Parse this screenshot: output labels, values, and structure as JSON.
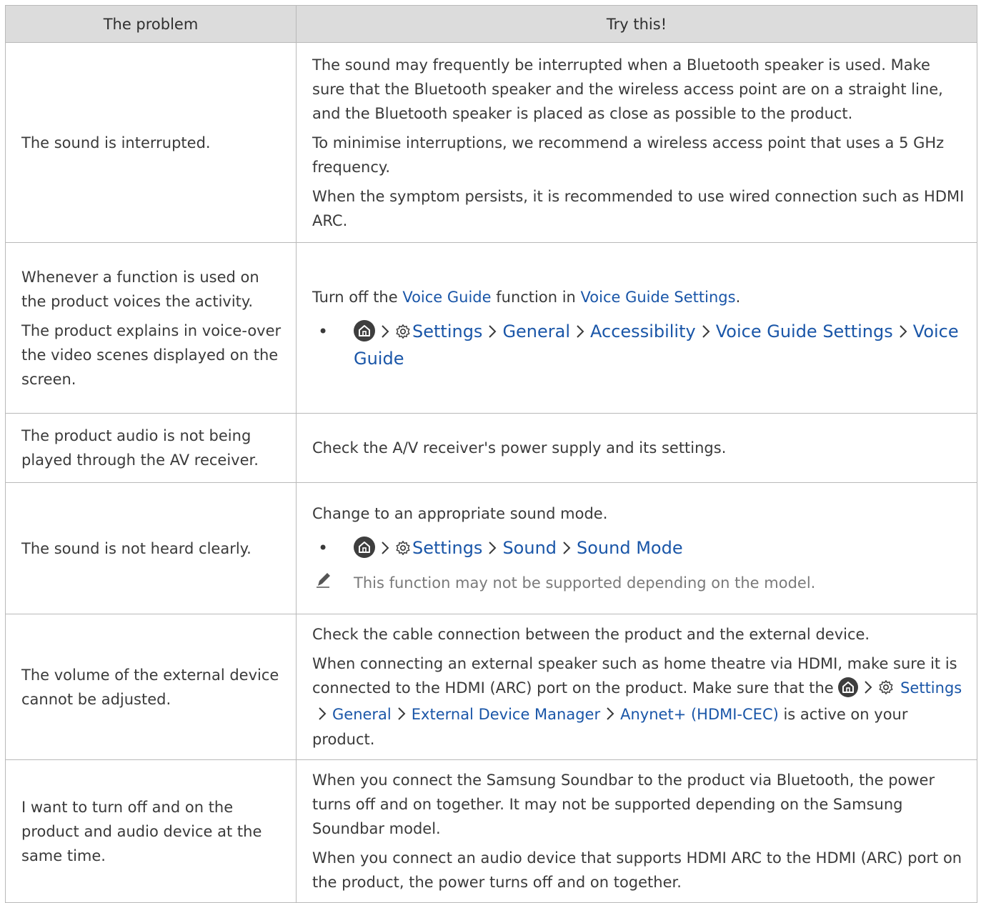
{
  "headers": {
    "problem": "The problem",
    "solution": "Try this!"
  },
  "rows": [
    {
      "problem": [
        "The sound is interrupted."
      ],
      "solution": [
        "The sound may frequently be interrupted when a Bluetooth speaker is used. Make sure that the Bluetooth speaker and the wireless access point are on a straight line, and the Bluetooth speaker is placed as close as possible to the product.",
        "To minimise interruptions, we recommend a wireless access point that uses a 5 GHz frequency.",
        "When the symptom persists, it is recommended to use wired connection such as HDMI ARC."
      ]
    },
    {
      "problem": [
        "Whenever a function is used on the product voices the activity.",
        "The product explains in voice-over the video scenes displayed on the screen."
      ],
      "solution_intro": {
        "before": "Turn off the ",
        "link1": "Voice Guide",
        "middle": " function in ",
        "link2": "Voice Guide Settings",
        "after": "."
      },
      "path": [
        "Settings",
        "General",
        "Accessibility",
        "Voice Guide Settings",
        "Voice Guide"
      ]
    },
    {
      "problem": [
        "The product audio is not being played through the AV receiver."
      ],
      "solution": [
        "Check the A/V receiver's power supply and its settings."
      ]
    },
    {
      "problem": [
        "The sound is not heard clearly."
      ],
      "solution": [
        "Change to an appropriate sound mode."
      ],
      "path": [
        "Settings",
        "Sound",
        "Sound Mode"
      ],
      "note": "This function may not be supported depending on the model."
    },
    {
      "problem": [
        "The volume of the external device cannot be adjusted."
      ],
      "solution": [
        "Check the cable connection between the product and the external device."
      ],
      "detail": {
        "before": "When connecting an external speaker such as home theatre via HDMI, make sure it is connected to the HDMI (ARC) port on the product. Make sure that the ",
        "path": [
          "Settings",
          "General",
          "External Device Manager",
          "Anynet+ (HDMI-CEC)"
        ],
        "after": " is active on your product."
      }
    },
    {
      "problem": [
        "I want to turn off and on the product and audio device at the same time."
      ],
      "solution": [
        "When you connect the Samsung Soundbar to the product via Bluetooth, the power turns off and on together. It may not be supported depending on the Samsung Soundbar model.",
        "When you connect an audio device that supports HDMI ARC to the HDMI (ARC) port on the product, the power turns off and on together."
      ]
    }
  ],
  "icons": {
    "home": "home-icon",
    "gear": "gear-icon",
    "chevron": "chevron-right-icon",
    "note": "pencil-icon"
  },
  "colors": {
    "header_bg": "#dcdcdc",
    "link": "#1a56a8",
    "border": "#b9b9b9",
    "text": "#3a3a3a"
  }
}
